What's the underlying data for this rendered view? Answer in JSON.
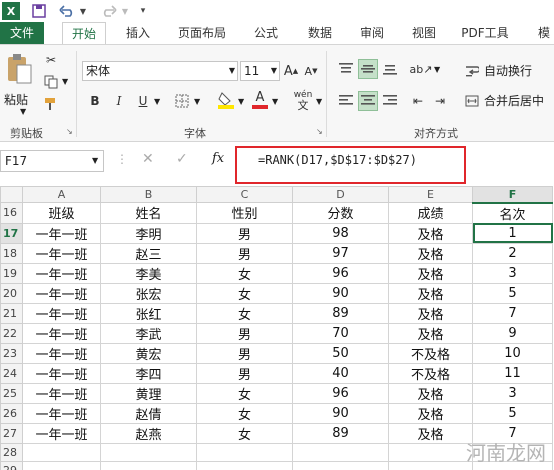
{
  "title_bar": {
    "icons": [
      "excel-logo-icon",
      "save-icon",
      "undo-icon",
      "redo-icon",
      "customize-icon"
    ]
  },
  "ribbon": {
    "tabs": [
      "文件",
      "开始",
      "插入",
      "页面布局",
      "公式",
      "数据",
      "审阅",
      "视图",
      "PDF工具",
      "模"
    ],
    "active_tab": "开始",
    "clipboard": {
      "paste_label": "粘贴",
      "group_label": "剪贴板"
    },
    "font": {
      "name": "宋体",
      "size": "11",
      "group_label": "字体",
      "bold": "B",
      "italic": "I",
      "underline": "U",
      "grow": "A",
      "shrink": "A",
      "font_color": "A",
      "wen": "wén"
    },
    "alignment": {
      "wrap_label": "自动换行",
      "merge_label": "合并后居中",
      "group_label": "对齐方式"
    }
  },
  "formula_bar": {
    "name_box": "F17",
    "cancel": "✕",
    "enter": "✓",
    "fx": "fx",
    "formula": "=RANK(D17,$D$17:$D$27)"
  },
  "sheet": {
    "columns": [
      "A",
      "B",
      "C",
      "D",
      "E",
      "F"
    ],
    "active_column": "F",
    "active_row": "17",
    "rows": [
      {
        "n": "16",
        "cells": [
          "班级",
          "姓名",
          "性别",
          "分数",
          "成绩",
          "名次"
        ]
      },
      {
        "n": "17",
        "cells": [
          "一年一班",
          "李明",
          "男",
          "98",
          "及格",
          "1"
        ]
      },
      {
        "n": "18",
        "cells": [
          "一年一班",
          "赵三",
          "男",
          "97",
          "及格",
          "2"
        ]
      },
      {
        "n": "19",
        "cells": [
          "一年一班",
          "李美",
          "女",
          "96",
          "及格",
          "3"
        ]
      },
      {
        "n": "20",
        "cells": [
          "一年一班",
          "张宏",
          "女",
          "90",
          "及格",
          "5"
        ]
      },
      {
        "n": "21",
        "cells": [
          "一年一班",
          "张红",
          "女",
          "89",
          "及格",
          "7"
        ]
      },
      {
        "n": "22",
        "cells": [
          "一年一班",
          "李武",
          "男",
          "70",
          "及格",
          "9"
        ]
      },
      {
        "n": "23",
        "cells": [
          "一年一班",
          "黄宏",
          "男",
          "50",
          "不及格",
          "10"
        ]
      },
      {
        "n": "24",
        "cells": [
          "一年一班",
          "李四",
          "男",
          "40",
          "不及格",
          "11"
        ]
      },
      {
        "n": "25",
        "cells": [
          "一年一班",
          "黄理",
          "女",
          "96",
          "及格",
          "3"
        ]
      },
      {
        "n": "26",
        "cells": [
          "一年一班",
          "赵倩",
          "女",
          "90",
          "及格",
          "5"
        ]
      },
      {
        "n": "27",
        "cells": [
          "一年一班",
          "赵燕",
          "女",
          "89",
          "及格",
          "7"
        ]
      },
      {
        "n": "28",
        "cells": [
          "",
          "",
          "",
          "",
          "",
          ""
        ]
      },
      {
        "n": "29",
        "cells": [
          "",
          "",
          "",
          "",
          "",
          ""
        ]
      }
    ]
  },
  "watermark": "河南龙网"
}
